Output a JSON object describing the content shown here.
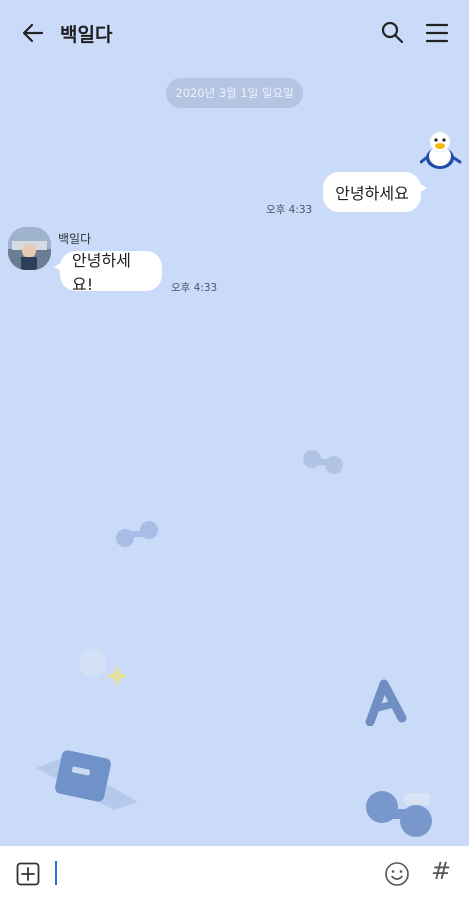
{
  "header": {
    "title": "백일다",
    "back_icon": "arrow-left-icon",
    "search_icon": "search-icon",
    "menu_icon": "hamburger-menu-icon"
  },
  "chat": {
    "date_divider": "2020년 3월 1일 일요일",
    "messages": [
      {
        "from": "me",
        "text": "안녕하세요",
        "time": "오후 4:33",
        "sticker": "duck-sticker"
      },
      {
        "from": "other",
        "sender": "백일다",
        "text": "안녕하세요!",
        "time": "오후 4:33"
      }
    ]
  },
  "input_bar": {
    "attach_icon": "plus-square-icon",
    "emoji_icon": "emoji-icon",
    "hash_label": "#"
  },
  "colors": {
    "background": "#c9dbf9",
    "bubble": "#ffffff",
    "date_pill": "#b3c5e2"
  }
}
